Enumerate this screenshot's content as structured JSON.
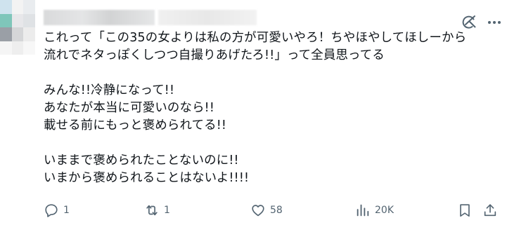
{
  "header": {
    "avatar_colors": [
      "#cfe3ee",
      "#f3f3f3",
      "#e9ecef",
      "#7fc6ba",
      "#e7e7ea",
      "#dfe2e5",
      "#9a9fa6",
      "#d5d6d8",
      "#ececec",
      "#f5f5f5",
      "#eeeeee",
      "#f7f7f7"
    ]
  },
  "post": {
    "lines": [
      "これって「この35の女よりは私の方が可愛いやろ！ちやほやしてほしーから",
      "流れでネタっぽくしつつ自撮りあげたろ!!」って全員思ってる",
      "",
      "みんな!!冷静になって!!",
      "あなたが本当に可愛いのなら!!",
      "載せる前にもっと褒められてる!!",
      "",
      "いままで褒められたことないのに!!",
      "いまから褒められることはないよ!!!!"
    ]
  },
  "actions": {
    "reply_count": "1",
    "repost_count": "1",
    "like_count": "58",
    "views_count": "20K"
  },
  "colors": {
    "text": "#0f1419",
    "muted": "#536471"
  }
}
